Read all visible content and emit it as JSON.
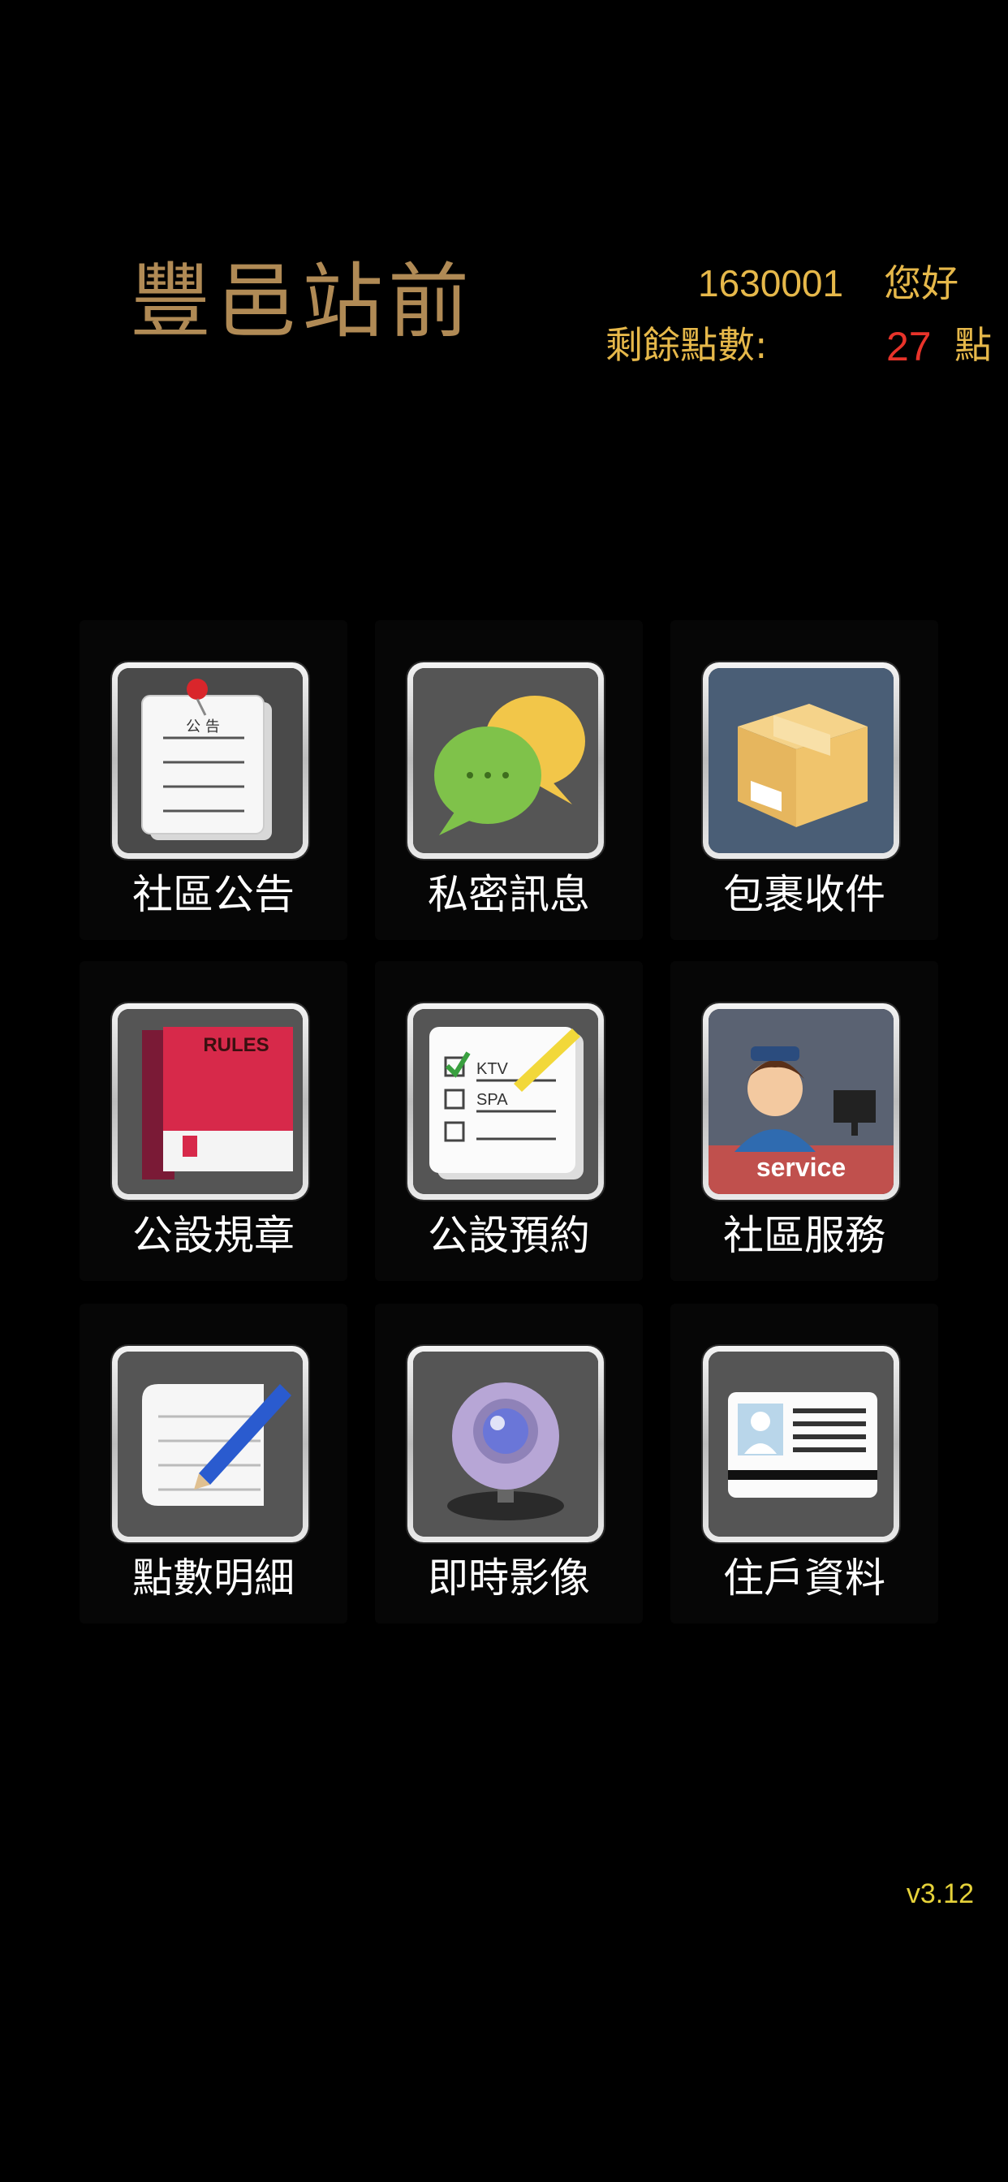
{
  "header": {
    "title": "豐邑站前",
    "user_id": "1630001",
    "greeting": "您好",
    "points_label": "剩餘點數:",
    "points_value": "27",
    "points_unit": "點"
  },
  "tiles": [
    {
      "label": "社區公告",
      "icon": "announcement-board-icon",
      "icon_text": "公 告"
    },
    {
      "label": "私密訊息",
      "icon": "chat-bubbles-icon"
    },
    {
      "label": "包裹收件",
      "icon": "package-box-icon"
    },
    {
      "label": "公設規章",
      "icon": "rules-book-icon",
      "icon_text": "RULES"
    },
    {
      "label": "公設預約",
      "icon": "checklist-icon",
      "icon_text": "KTV",
      "icon_text2": "SPA"
    },
    {
      "label": "社區服務",
      "icon": "service-agent-icon",
      "icon_text": "service"
    },
    {
      "label": "點數明細",
      "icon": "paper-pen-icon"
    },
    {
      "label": "即時影像",
      "icon": "webcam-icon"
    },
    {
      "label": "住戶資料",
      "icon": "id-card-icon"
    }
  ],
  "footer": {
    "version": "v3.12"
  },
  "colors": {
    "background": "#000000",
    "title": "#b08a55",
    "header_text": "#e6b84a",
    "points_value": "#e8332a",
    "version": "#e6d23a"
  }
}
